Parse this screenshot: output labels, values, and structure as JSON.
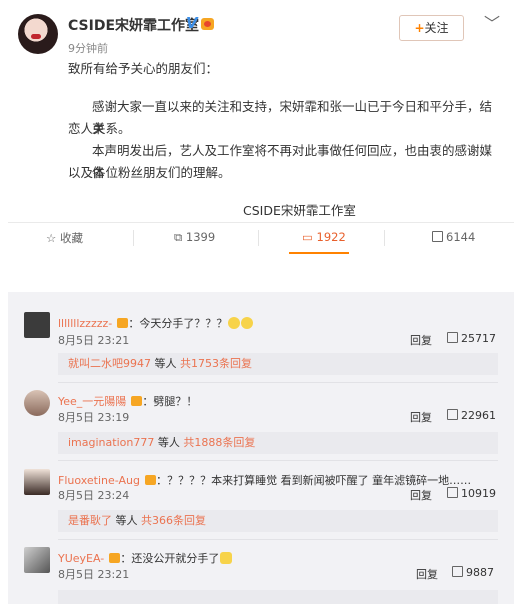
{
  "post": {
    "author": "CSIDE宋妍霏工作室",
    "verified_badge": "V",
    "time": "9分钟前",
    "follow_label": "关注",
    "greeting": "致所有给予关心的朋友们：",
    "para1": "感谢大家一直以来的关注和支持，宋妍霏和张一山已于今日和平分手，结束恋人关系。",
    "para1_line1": "感谢大家一直以来的关注和支持，宋妍霏和张一山已于今日和平分手，结束",
    "para1_line2": "恋人关系。",
    "para2_line1": "本声明发出后，艺人及工作室将不再对此事做任何回应，也由衷的感谢媒体",
    "para2_line2": "以及各位粉丝朋友们的理解。",
    "signature": "CSIDE宋妍霏工作室"
  },
  "actions": {
    "favorite_label": "收藏",
    "repost_count": "1399",
    "comment_count": "1922",
    "like_count": "6144"
  },
  "comments": [
    {
      "name": "lllllllzzzzz-",
      "text": "：今天分手了？？？",
      "date": "8月5日 23:21",
      "reply_label": "回复",
      "likes": "25717",
      "sub_name": "就叫二水吧9947",
      "sub_text": "等人",
      "sub_count": "共1753条回复"
    },
    {
      "name": "Yee_一元陽陽",
      "text": "：劈腿？！",
      "date": "8月5日 23:19",
      "reply_label": "回复",
      "likes": "22961",
      "sub_name": "imagination777",
      "sub_text": "等人",
      "sub_count": "共1888条回复"
    },
    {
      "name": "Fluoxetine-Aug",
      "text": "：？？？？本来打算睡觉 看到新闻被吓醒了 童年滤镜碎一地……",
      "date": "8月5日 23:24",
      "reply_label": "回复",
      "likes": "10919",
      "sub_name": "是番耿了",
      "sub_text": "等人",
      "sub_count": "共366条回复"
    },
    {
      "name": "YUeyEA-",
      "text": "：还没公开就分手了",
      "date": "8月5日 23:21",
      "reply_label": "回复",
      "likes": "9887"
    }
  ],
  "colors": {
    "accent": "#ff8200",
    "username": "#eb7350",
    "verified": "#3b8ee8"
  }
}
